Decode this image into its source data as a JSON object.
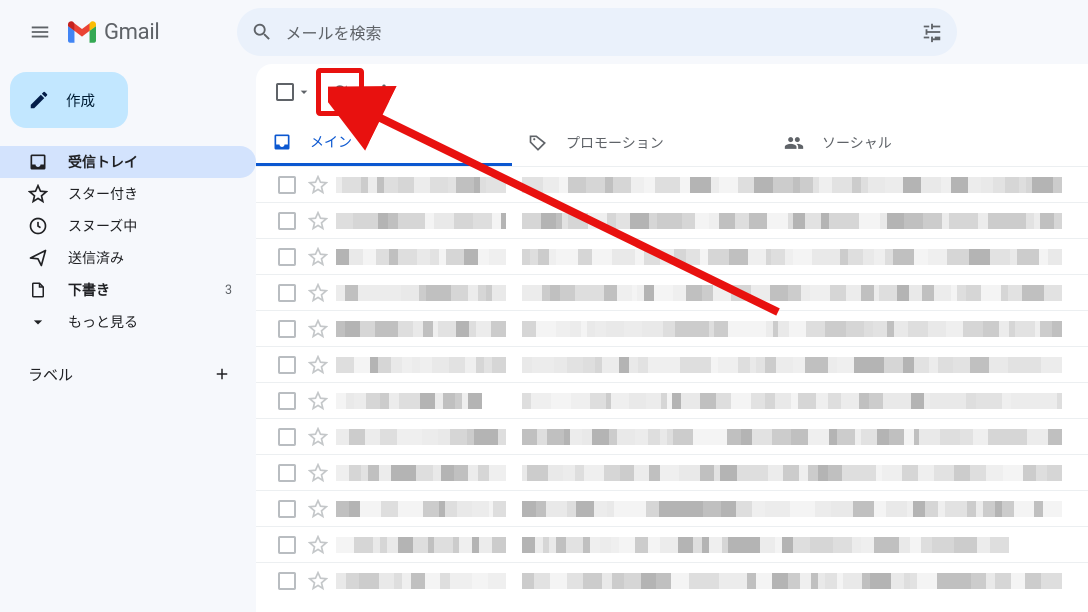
{
  "header": {
    "gmail_name": "Gmail",
    "search_placeholder": "メールを検索"
  },
  "sidebar": {
    "compose": "作成",
    "items": [
      {
        "key": "inbox",
        "label": "受信トレイ",
        "active": true
      },
      {
        "key": "starred",
        "label": "スター付き",
        "active": false
      },
      {
        "key": "snoozed",
        "label": "スヌーズ中",
        "active": false
      },
      {
        "key": "sent",
        "label": "送信済み",
        "active": false
      },
      {
        "key": "drafts",
        "label": "下書き",
        "active": false,
        "count": "3"
      },
      {
        "key": "more",
        "label": "もっと見る",
        "active": false
      }
    ],
    "labels_title": "ラベル"
  },
  "tabs": [
    {
      "key": "primary",
      "label": "メイン",
      "active": true
    },
    {
      "key": "promotions",
      "label": "プロモーション",
      "active": false
    },
    {
      "key": "social",
      "label": "ソーシャル",
      "active": false
    }
  ],
  "rows_count": 12,
  "colors": {
    "accent": "#0b57d0",
    "highlight_red": "#e8110f",
    "search_bg": "#eaf1fb",
    "compose_bg": "#c2e7ff",
    "nav_active_bg": "#d3e3fd"
  },
  "pixel_grays": [
    "#f4f4f4",
    "#ececec",
    "#e2e2e2",
    "#d6d6d6",
    "#cccccc",
    "#c0c0c0",
    "#b4b4b4",
    "#e9e9e9",
    "#efefef",
    "#dedede"
  ]
}
